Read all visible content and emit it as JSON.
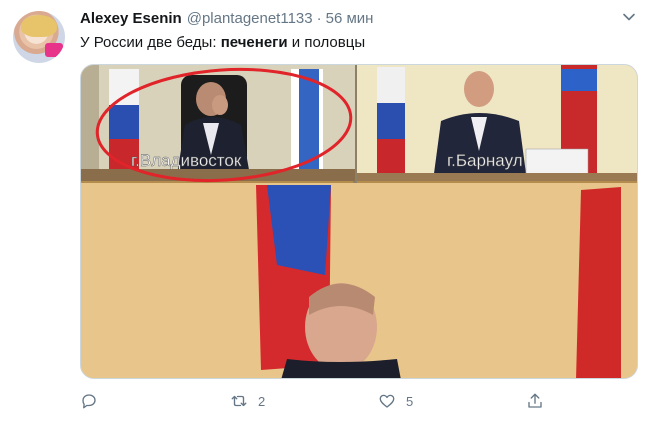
{
  "tweet": {
    "author_name": "Alexey Esenin",
    "handle": "@plantagenet1133",
    "separator": "·",
    "time": "56 мин",
    "text_before": "У России две беды: ",
    "text_bold": "печенеги",
    "text_after": " и половцы"
  },
  "media": {
    "caption_left": "г.Владивосток",
    "caption_right": "г.Барнаул"
  },
  "actions": {
    "reply_count": "",
    "retweet_count": "2",
    "like_count": "5",
    "share_count": ""
  },
  "icons": {
    "reply": "reply-icon",
    "retweet": "retweet-icon",
    "like": "heart-icon",
    "share": "share-icon",
    "menu": "chevron-down-icon"
  },
  "colors": {
    "secondary_text": "#657786",
    "annotation_circle": "#e0242a"
  }
}
